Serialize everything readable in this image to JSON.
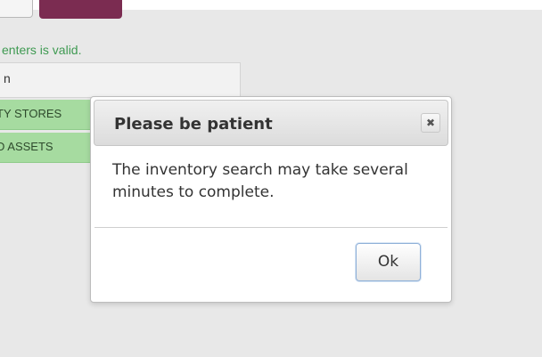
{
  "background": {
    "validation_message": "enters is valid.",
    "input_value": "n",
    "result_rows": [
      {
        "label": "TY STORES",
        "color": "#a6dba0"
      },
      {
        "label": "D ASSETS",
        "color": "#a6dba0"
      }
    ],
    "primary_button_color": "#7b2c51"
  },
  "dialog": {
    "title": "Please be patient",
    "close_icon": "close-icon",
    "message": "The inventory search may take several minutes to complete.",
    "ok_label": "Ok"
  }
}
